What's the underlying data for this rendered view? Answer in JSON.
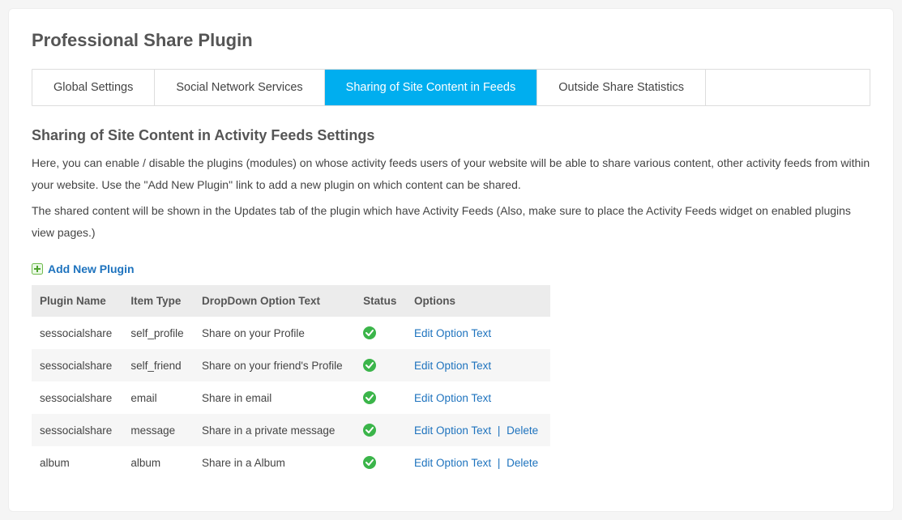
{
  "header": {
    "title": "Professional Share Plugin"
  },
  "tabs": [
    {
      "label": "Global Settings",
      "active": false
    },
    {
      "label": "Social Network Services",
      "active": false
    },
    {
      "label": "Sharing of Site Content in Feeds",
      "active": true
    },
    {
      "label": "Outside Share Statistics",
      "active": false
    }
  ],
  "section": {
    "title": "Sharing of Site Content in Activity Feeds Settings",
    "desc1": "Here, you can enable / disable the plugins (modules) on whose activity feeds users of your website will be able to share various content, other activity feeds from within your website. Use the \"Add New Plugin\" link to add a new plugin on which content can be shared.",
    "desc2": "The shared content will be shown in the Updates tab of the plugin which have Activity Feeds (Also, make sure to place the Activity Feeds widget on enabled plugins view pages.)"
  },
  "add_link": {
    "label": "Add New Plugin"
  },
  "table": {
    "headers": {
      "plugin_name": "Plugin Name",
      "item_type": "Item Type",
      "dropdown_text": "DropDown Option Text",
      "status": "Status",
      "options": "Options"
    },
    "actions": {
      "edit": "Edit Option Text",
      "delete": "Delete",
      "separator": "|"
    },
    "rows": [
      {
        "plugin_name": "sessocialshare",
        "item_type": "self_profile",
        "dropdown_text": "Share on your Profile",
        "status": "enabled",
        "can_delete": false
      },
      {
        "plugin_name": "sessocialshare",
        "item_type": "self_friend",
        "dropdown_text": "Share on your friend's Profile",
        "status": "enabled",
        "can_delete": false
      },
      {
        "plugin_name": "sessocialshare",
        "item_type": "email",
        "dropdown_text": "Share in email",
        "status": "enabled",
        "can_delete": false
      },
      {
        "plugin_name": "sessocialshare",
        "item_type": "message",
        "dropdown_text": "Share in a private message",
        "status": "enabled",
        "can_delete": true
      },
      {
        "plugin_name": "album",
        "item_type": "album",
        "dropdown_text": "Share in a Album",
        "status": "enabled",
        "can_delete": true
      }
    ]
  }
}
